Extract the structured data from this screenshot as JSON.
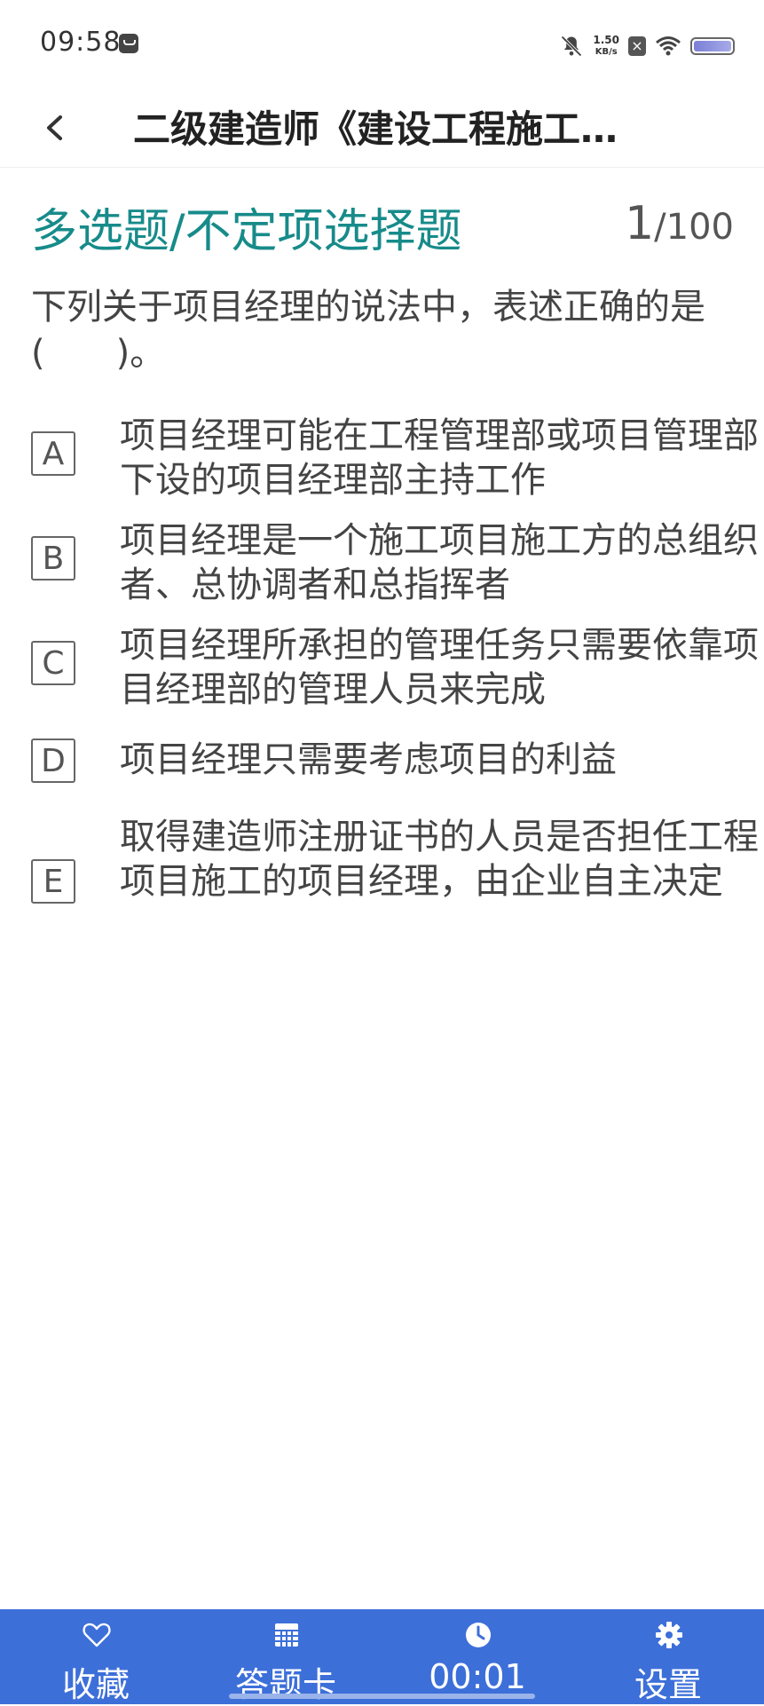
{
  "status_bar": {
    "time": "09:58",
    "net_speed_value": "1.50",
    "net_speed_unit": "KB/s",
    "icons": [
      "message-icon",
      "bell-off-icon",
      "sim-x-icon",
      "wifi-icon",
      "battery-icon"
    ]
  },
  "nav": {
    "title": "二级建造师《建设工程施工…"
  },
  "question": {
    "type": "多选题/不定项选择题",
    "current": "1",
    "total": "/100",
    "stem": "下列关于项目经理的说法中，表述正确的是(　　)。",
    "options": [
      {
        "letter": "A",
        "text": "项目经理可能在工程管理部或项目管理部下设的项目经理部主持工作"
      },
      {
        "letter": "B",
        "text": "项目经理是一个施工项目施工方的总组织者、总协调者和总指挥者"
      },
      {
        "letter": "C",
        "text": "项目经理所承担的管理任务只需要依靠项目经理部的管理人员来完成"
      },
      {
        "letter": "D",
        "text": "项目经理只需要考虑项目的利益"
      },
      {
        "letter": "E",
        "text": "取得建造师注册证书的人员是否担任工程项目施工的项目经理，由企业自主决定"
      }
    ]
  },
  "bottom_bar": {
    "favorite_label": "收藏",
    "answer_card_label": "答题卡",
    "timer": "00:01",
    "settings_label": "设置"
  },
  "colors": {
    "accent_teal": "#178b8a",
    "bottom_bar_blue": "#3d6fd9"
  }
}
